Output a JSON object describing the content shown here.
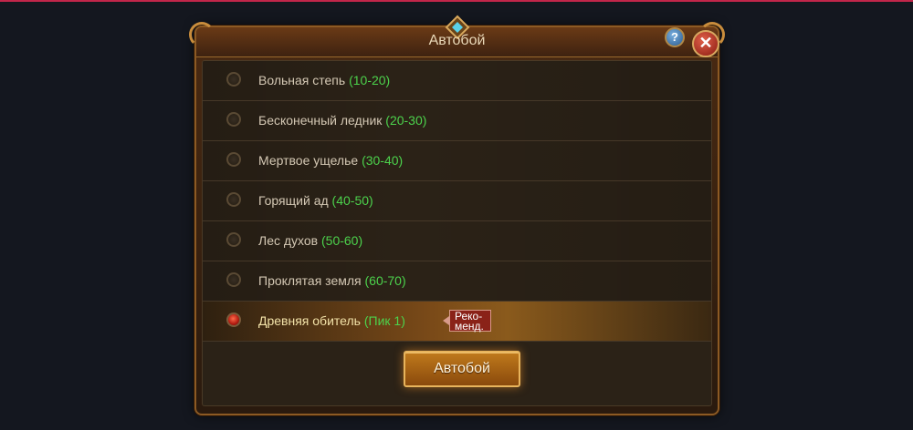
{
  "dialog": {
    "title": "Автобой",
    "help_label": "?",
    "close_label": "✕",
    "zones": [
      {
        "name": "Вольная степь",
        "range": "(10-20)",
        "selected": false
      },
      {
        "name": "Бесконечный ледник",
        "range": "(20-30)",
        "selected": false
      },
      {
        "name": "Мертвое ущелье",
        "range": "(30-40)",
        "selected": false
      },
      {
        "name": "Горящий ад",
        "range": "(40-50)",
        "selected": false
      },
      {
        "name": "Лес духов",
        "range": "(50-60)",
        "selected": false
      },
      {
        "name": "Проклятая земля",
        "range": "(60-70)",
        "selected": false
      },
      {
        "name": "Древняя обитель",
        "range": "(Пик 1)",
        "selected": true
      }
    ],
    "recommended_badge": "Реко-\nменд.",
    "auto_button_label": "Автобой"
  },
  "colors": {
    "range_text": "#4cd24c",
    "accent_gold": "#c98d3c",
    "selected_radio": "#b01a10"
  }
}
